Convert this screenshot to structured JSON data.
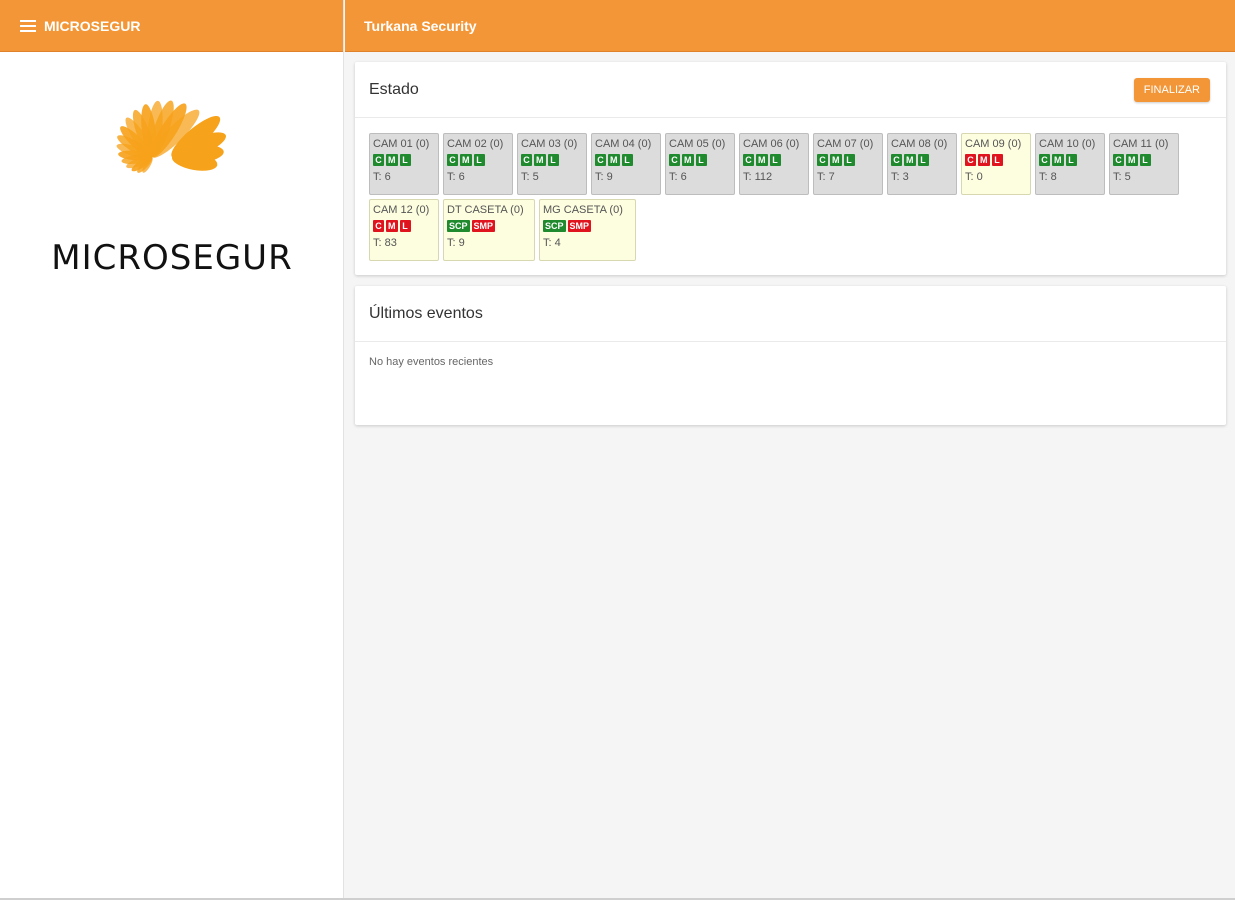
{
  "sidebar": {
    "brand": "MICROSEGUR",
    "logo_text": "MICROSEGUR"
  },
  "topbar": {
    "title": "Turkana Security"
  },
  "estado": {
    "title": "Estado",
    "finalize_label": "FINALIZAR",
    "tiles": [
      {
        "name": "CAM 01 (0)",
        "status": "gray",
        "badges": [
          {
            "t": "C",
            "s": "ok"
          },
          {
            "t": "M",
            "s": "ok"
          },
          {
            "t": "L",
            "s": "ok"
          }
        ],
        "t": "T: 6"
      },
      {
        "name": "CAM 02 (0)",
        "status": "gray",
        "badges": [
          {
            "t": "C",
            "s": "ok"
          },
          {
            "t": "M",
            "s": "ok"
          },
          {
            "t": "L",
            "s": "ok"
          }
        ],
        "t": "T: 6"
      },
      {
        "name": "CAM 03 (0)",
        "status": "gray",
        "badges": [
          {
            "t": "C",
            "s": "ok"
          },
          {
            "t": "M",
            "s": "ok"
          },
          {
            "t": "L",
            "s": "ok"
          }
        ],
        "t": "T: 5"
      },
      {
        "name": "CAM 04 (0)",
        "status": "gray",
        "badges": [
          {
            "t": "C",
            "s": "ok"
          },
          {
            "t": "M",
            "s": "ok"
          },
          {
            "t": "L",
            "s": "ok"
          }
        ],
        "t": "T: 9"
      },
      {
        "name": "CAM 05 (0)",
        "status": "gray",
        "badges": [
          {
            "t": "C",
            "s": "ok"
          },
          {
            "t": "M",
            "s": "ok"
          },
          {
            "t": "L",
            "s": "ok"
          }
        ],
        "t": "T: 6"
      },
      {
        "name": "CAM 06 (0)",
        "status": "gray",
        "badges": [
          {
            "t": "C",
            "s": "ok"
          },
          {
            "t": "M",
            "s": "ok"
          },
          {
            "t": "L",
            "s": "ok"
          }
        ],
        "t": "T: 112"
      },
      {
        "name": "CAM 07 (0)",
        "status": "gray",
        "badges": [
          {
            "t": "C",
            "s": "ok"
          },
          {
            "t": "M",
            "s": "ok"
          },
          {
            "t": "L",
            "s": "ok"
          }
        ],
        "t": "T: 7"
      },
      {
        "name": "CAM 08 (0)",
        "status": "gray",
        "badges": [
          {
            "t": "C",
            "s": "ok"
          },
          {
            "t": "M",
            "s": "ok"
          },
          {
            "t": "L",
            "s": "ok"
          }
        ],
        "t": "T: 3"
      },
      {
        "name": "CAM 09 (0)",
        "status": "yellow",
        "badges": [
          {
            "t": "C",
            "s": "bad"
          },
          {
            "t": "M",
            "s": "bad"
          },
          {
            "t": "L",
            "s": "bad"
          }
        ],
        "t": "T: 0"
      },
      {
        "name": "CAM 10 (0)",
        "status": "gray",
        "badges": [
          {
            "t": "C",
            "s": "ok"
          },
          {
            "t": "M",
            "s": "ok"
          },
          {
            "t": "L",
            "s": "ok"
          }
        ],
        "t": "T: 8"
      },
      {
        "name": "CAM 11 (0)",
        "status": "gray",
        "badges": [
          {
            "t": "C",
            "s": "ok"
          },
          {
            "t": "M",
            "s": "ok"
          },
          {
            "t": "L",
            "s": "ok"
          }
        ],
        "t": "T: 5"
      },
      {
        "name": "CAM 12 (0)",
        "status": "yellow",
        "badges": [
          {
            "t": "C",
            "s": "bad"
          },
          {
            "t": "M",
            "s": "bad"
          },
          {
            "t": "L",
            "s": "bad"
          }
        ],
        "t": "T: 83"
      },
      {
        "name": "DT CASETA (0)",
        "status": "yellow",
        "badges": [
          {
            "t": "SCP",
            "s": "ok"
          },
          {
            "t": "SMP",
            "s": "bad"
          }
        ],
        "t": "T: 9"
      },
      {
        "name": "MG CASETA (0)",
        "status": "yellow",
        "badges": [
          {
            "t": "SCP",
            "s": "ok"
          },
          {
            "t": "SMP",
            "s": "bad"
          }
        ],
        "t": "T: 4"
      }
    ]
  },
  "events": {
    "title": "Últimos eventos",
    "empty_text": "No hay eventos recientes"
  },
  "colors": {
    "accent": "#f39637",
    "ok": "#1f8a2e",
    "bad": "#e0141e",
    "tile_gray": "#dcdcdc",
    "tile_yellow": "#fdfde0"
  }
}
